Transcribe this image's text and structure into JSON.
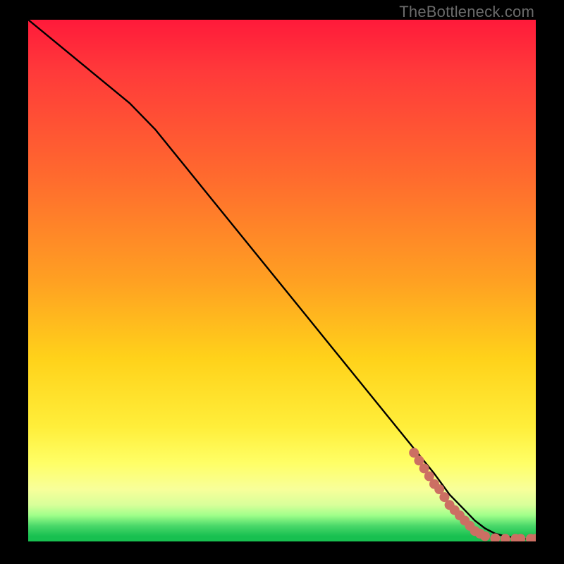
{
  "watermark": "TheBottleneck.com",
  "chart_data": {
    "type": "line",
    "title": "",
    "xlabel": "",
    "ylabel": "",
    "xlim": [
      0,
      100
    ],
    "ylim": [
      0,
      100
    ],
    "grid": false,
    "legend": false,
    "series": [
      {
        "name": "curve",
        "color": "#000000",
        "x": [
          0,
          5,
          10,
          15,
          20,
          25,
          30,
          35,
          40,
          45,
          50,
          55,
          60,
          65,
          70,
          75,
          80,
          83,
          86,
          88,
          90,
          92,
          94,
          96,
          98,
          100
        ],
        "y": [
          100,
          96,
          92,
          88,
          84,
          79,
          73,
          67,
          61,
          55,
          49,
          43,
          37,
          31,
          25,
          19,
          13,
          9,
          6,
          4,
          2.5,
          1.5,
          1,
          0.7,
          0.5,
          0.5
        ]
      }
    ],
    "markers": {
      "name": "highlight-segment",
      "color": "#cc6f63",
      "radius_px": 7,
      "points": [
        {
          "x": 76,
          "y": 17
        },
        {
          "x": 77,
          "y": 15.5
        },
        {
          "x": 78,
          "y": 14
        },
        {
          "x": 79,
          "y": 12.5
        },
        {
          "x": 80,
          "y": 11
        },
        {
          "x": 81,
          "y": 10
        },
        {
          "x": 82,
          "y": 8.5
        },
        {
          "x": 83,
          "y": 7
        },
        {
          "x": 84,
          "y": 6
        },
        {
          "x": 85,
          "y": 5
        },
        {
          "x": 86,
          "y": 4
        },
        {
          "x": 87,
          "y": 3
        },
        {
          "x": 88,
          "y": 2
        },
        {
          "x": 89,
          "y": 1.5
        },
        {
          "x": 90,
          "y": 1
        },
        {
          "x": 92,
          "y": 0.6
        },
        {
          "x": 94,
          "y": 0.5
        },
        {
          "x": 96,
          "y": 0.5
        },
        {
          "x": 97,
          "y": 0.5
        },
        {
          "x": 99,
          "y": 0.5
        },
        {
          "x": 100,
          "y": 0.5
        }
      ]
    },
    "background_gradient": {
      "orientation": "vertical",
      "stops": [
        {
          "pos": 0.0,
          "color": "#ff1a3a"
        },
        {
          "pos": 0.5,
          "color": "#ffa022"
        },
        {
          "pos": 0.8,
          "color": "#ffee3a"
        },
        {
          "pos": 0.95,
          "color": "#a0ff8a"
        },
        {
          "pos": 1.0,
          "color": "#18c050"
        }
      ]
    }
  }
}
